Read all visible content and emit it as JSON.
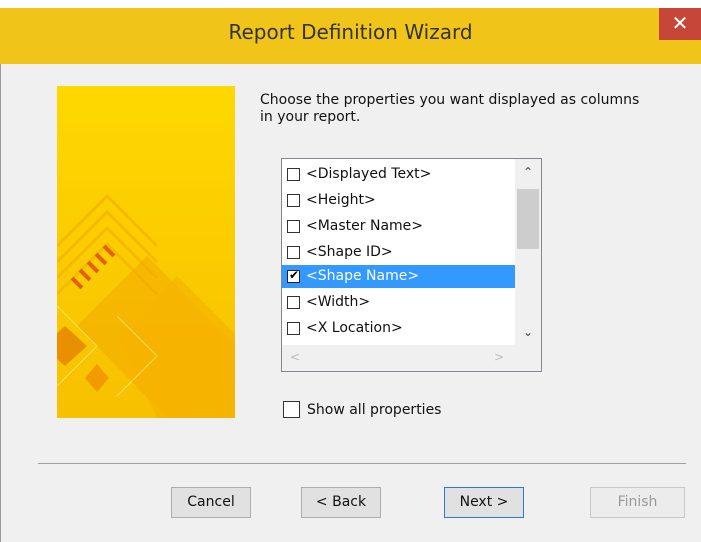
{
  "window": {
    "title": "Report Definition Wizard",
    "close_glyph": "✕",
    "accent_color": "#f0c419",
    "close_color": "#c7463a"
  },
  "instructions": "Choose the properties you want displayed as columns in your report.",
  "properties_list": {
    "items": [
      {
        "label": "<Displayed Text>",
        "checked": false,
        "selected": false
      },
      {
        "label": "<Height>",
        "checked": false,
        "selected": false
      },
      {
        "label": "<Master Name>",
        "checked": false,
        "selected": false
      },
      {
        "label": "<Shape ID>",
        "checked": false,
        "selected": false
      },
      {
        "label": "<Shape Name>",
        "checked": true,
        "selected": true
      },
      {
        "label": "<Width>",
        "checked": false,
        "selected": false
      },
      {
        "label": "<X Location>",
        "checked": false,
        "selected": false
      }
    ],
    "scroll_up_glyph": "⌃",
    "scroll_down_glyph": "⌄",
    "scroll_left_glyph": "<",
    "scroll_right_glyph": ">",
    "check_glyph": "✔"
  },
  "show_all": {
    "label": "Show all properties",
    "checked": false
  },
  "buttons": {
    "cancel": "Cancel",
    "back": "< Back",
    "next": "Next >",
    "finish": "Finish"
  },
  "icons": {
    "close": "close-icon",
    "banner": "wizard-banner-image"
  }
}
